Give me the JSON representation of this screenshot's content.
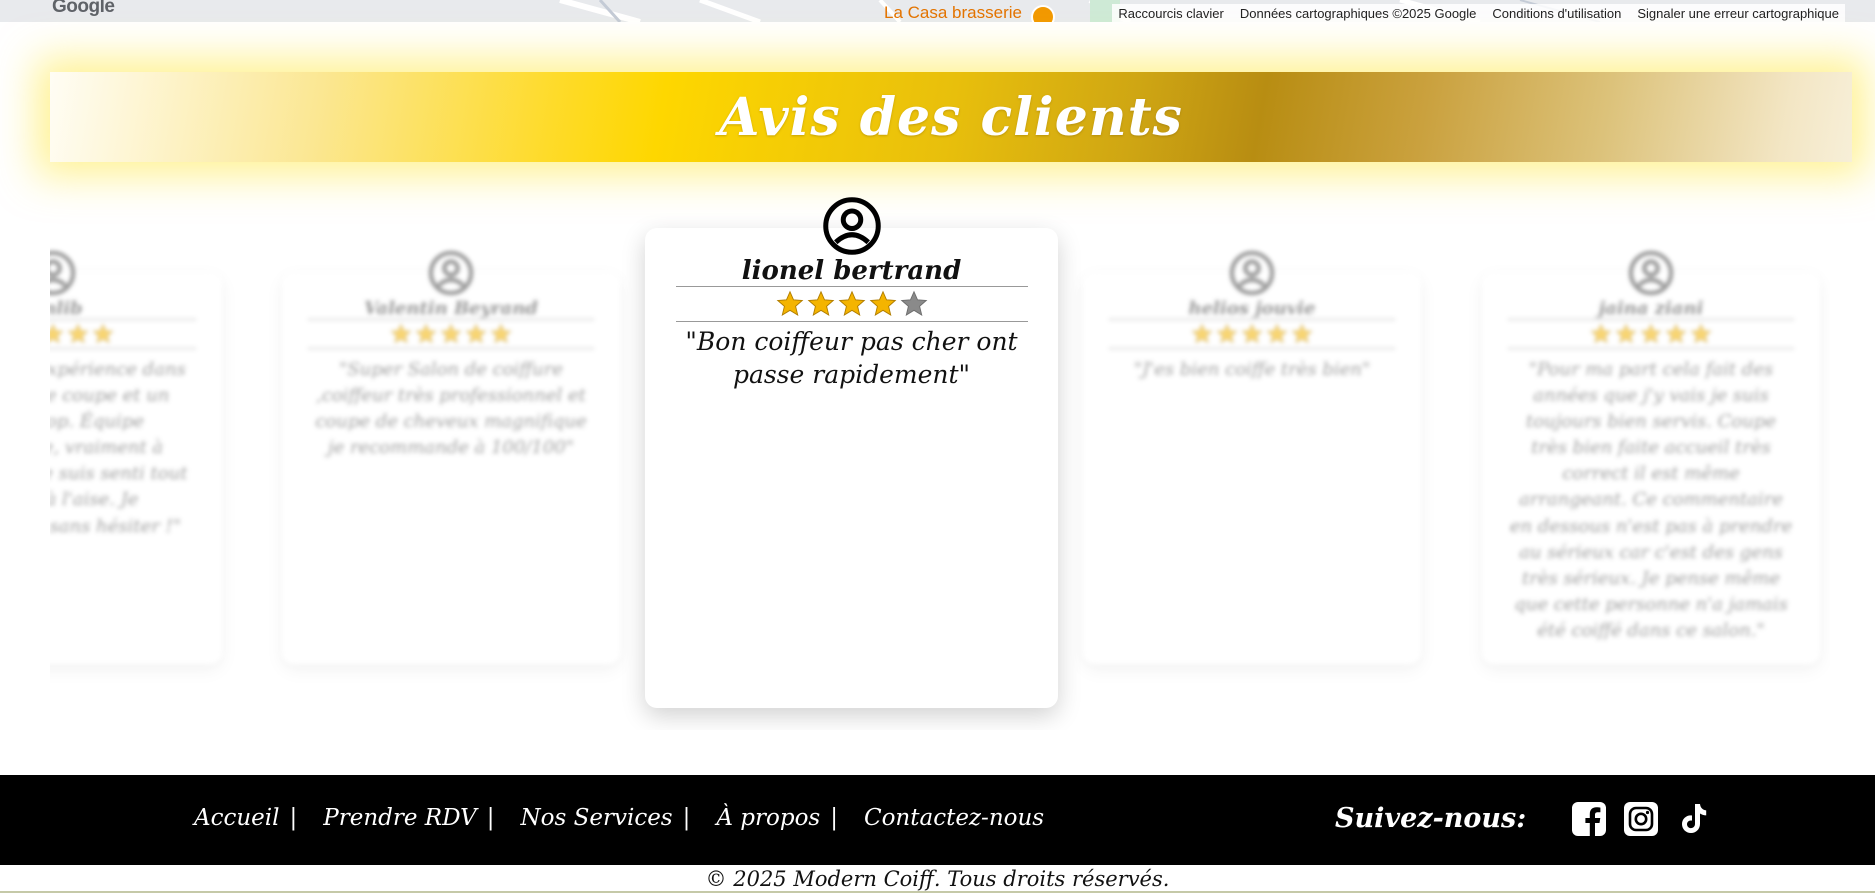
{
  "map": {
    "logo": "Google",
    "poi_name": "La Casa brasserie",
    "attribution": [
      "Raccourcis clavier",
      "Données cartographiques ©2025 Google",
      "Conditions d'utilisation",
      "Signaler une erreur cartographique"
    ]
  },
  "reviews_section": {
    "title": "Avis des clients",
    "max_stars": 5,
    "star_color": "#f4b400",
    "star_empty_color": "#8a8a8a",
    "reviews": [
      {
        "name": "Amlib",
        "rating": 5,
        "comment": "\"Très bonne expérience dans ce salon, une coupe et un résultat top. Équipe accueillante, vraiment à l'écoute. Je me suis senti tout de suite à l'aise. Je recommande sans hésiter !\""
      },
      {
        "name": "Valentin Beyrand",
        "rating": 5,
        "comment": "\"Super Salon de coiffure ,coiffeur très professionnel et coupe de cheveux magnifique je recommande à 100/100\""
      },
      {
        "name": "lionel bertrand",
        "rating": 4,
        "comment": "\"Bon coiffeur pas cher ont passe rapidement\""
      },
      {
        "name": "helios jouvie",
        "rating": 5,
        "comment": "\"J'es bien coiffe très bien\""
      },
      {
        "name": "jaina ziani",
        "rating": 5,
        "comment": "\"Pour ma part cela fait des années que j'y vais je suis toujours bien servis. Coupe très bien faite accueil très correct il est même arrangeant. Ce commentaire en dessous n'est pas à prendre au sérieux car c'est des gens très sérieux. Je pense même que cette personne n'a jamais été coiffé dans ce salon.\""
      }
    ]
  },
  "footer": {
    "nav": [
      "Accueil",
      "Prendre RDV",
      "Nos Services",
      "À propos",
      "Contactez-nous"
    ],
    "separator": "|",
    "follow_label": "Suivez-nous:",
    "social": [
      "facebook-icon",
      "instagram-icon",
      "tiktok-icon"
    ],
    "copyright": "© 2025 Modern Coiff. Tous droits réservés."
  }
}
